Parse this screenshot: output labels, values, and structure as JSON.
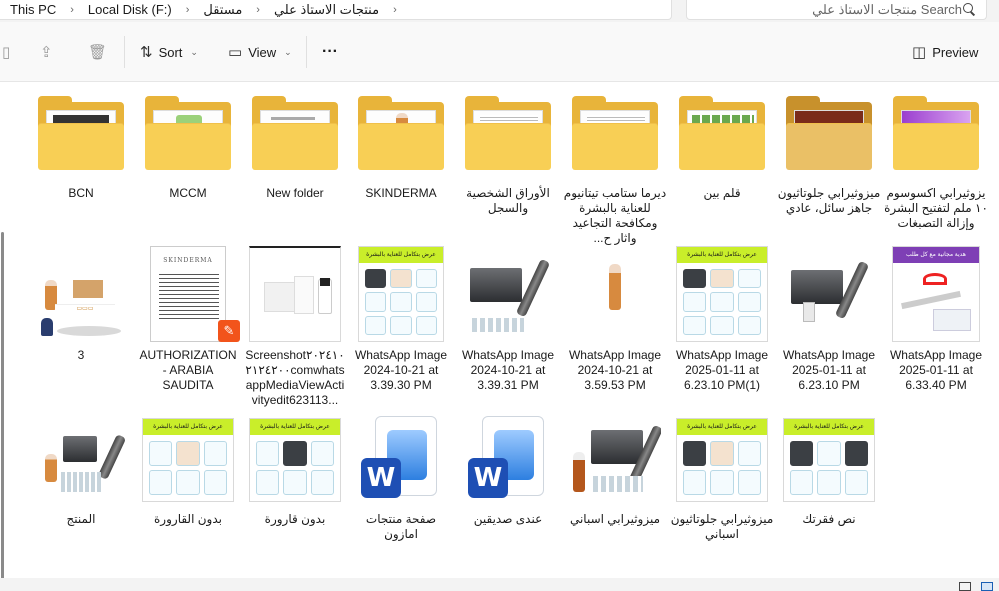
{
  "breadcrumb": [
    "This PC",
    "Local Disk (F:)",
    "مستقل",
    "منتجات الاستاذ علي"
  ],
  "search": {
    "placeholder": "Search منتجات الاستاذ علي"
  },
  "toolbar": {
    "sort_label": "Sort",
    "view_label": "View",
    "more_label": "···",
    "preview_label": "Preview"
  },
  "rows": [
    [
      {
        "name": "BCN",
        "kind": "folder"
      },
      {
        "name": "MCCM",
        "kind": "folder"
      },
      {
        "name": "New folder",
        "kind": "folder"
      },
      {
        "name": "SKINDERMA",
        "kind": "folder"
      },
      {
        "name": "الأوراق الشخصية والسجل",
        "kind": "folder"
      },
      {
        "name": "ديرما ستامب تيتانيوم للعناية بالبشرة ومكافحة التجاعيد واثار ح...",
        "kind": "folder"
      },
      {
        "name": "قلم بين",
        "kind": "folder"
      },
      {
        "name": "ميزوثيرابي جلوتاثيون جاهز سائل، عادي",
        "kind": "folder"
      },
      {
        "name": "يزوثيرابي اكسوسوم ١٠ ملم لتفتيح البشرة وإزالة التصبغات",
        "kind": "folder"
      }
    ],
    [
      {
        "name": "3",
        "kind": "image"
      },
      {
        "name": "AUTHORIZATION - ARABIA SAUDITA",
        "kind": "doc"
      },
      {
        "name": "Screenshot٢٠٢٤١٠٢١٢٤٢٠٠comwhatsappMediaViewActivityedit623113...",
        "kind": "image"
      },
      {
        "name": "WhatsApp Image 2024-10-21 at 3.39.30 PM",
        "kind": "image"
      },
      {
        "name": "WhatsApp Image 2024-10-21 at 3.39.31 PM",
        "kind": "image"
      },
      {
        "name": "WhatsApp Image 2024-10-21 at 3.59.53 PM",
        "kind": "image"
      },
      {
        "name": "WhatsApp Image 2025-01-11 at 6.23.10 PM(1)",
        "kind": "image"
      },
      {
        "name": "WhatsApp Image 2025-01-11 at 6.23.10 PM",
        "kind": "image"
      },
      {
        "name": "WhatsApp Image 2025-01-11 at 6.33.40 PM",
        "kind": "image"
      }
    ],
    [
      {
        "name": "المنتج",
        "kind": "image"
      },
      {
        "name": "بدون القارورة",
        "kind": "image"
      },
      {
        "name": "بدون قارورة",
        "kind": "image"
      },
      {
        "name": "صفحة منتجات امازون",
        "kind": "word"
      },
      {
        "name": "عندى صديقين",
        "kind": "word"
      },
      {
        "name": "ميزوثيرابي اسباني",
        "kind": "image"
      },
      {
        "name": "ميزوثيرابي جلوتاثيون اسباني",
        "kind": "image"
      },
      {
        "name": "نص فقرتك",
        "kind": "image"
      }
    ]
  ],
  "thumb_text": {
    "skinderma_logo": "SKINDERMA",
    "promo_banner": "عرض بتكامل للعناية بالبشرة",
    "word_letter": "W",
    "gift_banner": "هدية مجانية مع كل طلب"
  },
  "colors": {
    "folder_back": "#e8b43a",
    "folder_front": "#f8cf55",
    "promo_green": "#c9ee2a",
    "word_blue": "#1e4fb4"
  }
}
